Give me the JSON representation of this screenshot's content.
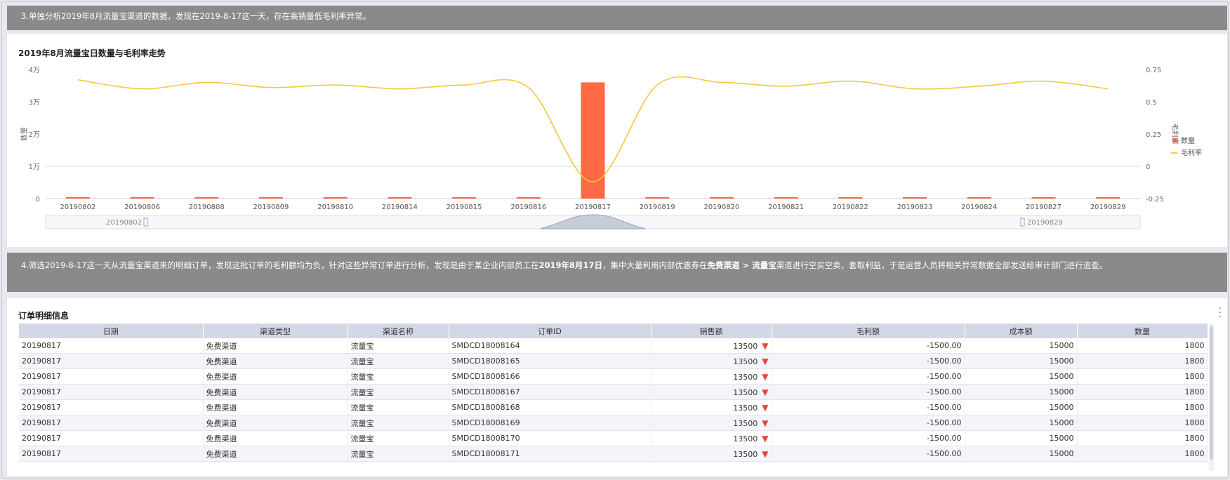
{
  "banners": {
    "top": "3.单独分析2019年8月流量宝渠道的数据，发现在2019-8-17这一天，存在高销量低毛利率异常。",
    "bottom_parts": [
      {
        "t": "4.筛选2019-8-17这一天从流量宝渠道来的明细订单，发现这批订单的毛利额均为负，针对这些异常订单进行分析，发现是由于某企业内部员工在",
        "b": false
      },
      {
        "t": "2019年8月17日",
        "b": true
      },
      {
        "t": "，集中大量利用内部优惠券在",
        "b": false
      },
      {
        "t": "免费渠道 > 流量宝",
        "b": true
      },
      {
        "t": "渠道进行空买空卖，套取利益，于是运营人员将相关异常数据全部发送给审计部门进行追查。",
        "b": false
      }
    ]
  },
  "chart": {
    "title": "2019年8月流量宝日数量与毛利率走势",
    "zoom_start": "20190802",
    "zoom_end": "20190829"
  },
  "chart_data": {
    "type": "bar+line",
    "categories": [
      "20190802",
      "20190806",
      "20190808",
      "20190809",
      "20190810",
      "20190814",
      "20190815",
      "20190816",
      "20190817",
      "20190819",
      "20190820",
      "20190821",
      "20190822",
      "20190823",
      "20190824",
      "20190827",
      "20190829"
    ],
    "series": [
      {
        "name": "数量",
        "type": "bar",
        "axis": "left",
        "color": "#ff6a45",
        "values": [
          200,
          300,
          250,
          250,
          350,
          250,
          200,
          300,
          36000,
          250,
          300,
          250,
          250,
          250,
          300,
          250,
          200
        ]
      },
      {
        "name": "毛利率",
        "type": "line",
        "axis": "right",
        "color": "#f5c842",
        "values": [
          0.67,
          0.6,
          0.65,
          0.61,
          0.63,
          0.6,
          0.63,
          0.61,
          -0.12,
          0.63,
          0.65,
          0.62,
          0.66,
          0.6,
          0.62,
          0.66,
          0.6
        ]
      }
    ],
    "ylabel_left": "数量",
    "ylabel_right": "毛利率",
    "ylim_left": [
      0,
      40000
    ],
    "ylim_right": [
      -0.25,
      0.75
    ],
    "yticks_left": [
      "0",
      "1万",
      "2万",
      "3万",
      "4万"
    ],
    "yticks_right": [
      "-0.25",
      "0",
      "0.25",
      "0.5",
      "0.75"
    ],
    "legend_position": "right"
  },
  "table": {
    "title": "订单明细信息",
    "columns": [
      "日期",
      "渠道类型",
      "渠道名称",
      "订单ID",
      "销售额",
      "毛利额",
      "成本额",
      "数量"
    ],
    "rows": [
      [
        "20190817",
        "免费渠道",
        "流量宝",
        "SMDCD18008164",
        "13500",
        "-1500.00",
        "15000",
        "1800"
      ],
      [
        "20190817",
        "免费渠道",
        "流量宝",
        "SMDCD18008165",
        "13500",
        "-1500.00",
        "15000",
        "1800"
      ],
      [
        "20190817",
        "免费渠道",
        "流量宝",
        "SMDCD18008166",
        "13500",
        "-1500.00",
        "15000",
        "1800"
      ],
      [
        "20190817",
        "免费渠道",
        "流量宝",
        "SMDCD18008167",
        "13500",
        "-1500.00",
        "15000",
        "1800"
      ],
      [
        "20190817",
        "免费渠道",
        "流量宝",
        "SMDCD18008168",
        "13500",
        "-1500.00",
        "15000",
        "1800"
      ],
      [
        "20190817",
        "免费渠道",
        "流量宝",
        "SMDCD18008169",
        "13500",
        "-1500.00",
        "15000",
        "1800"
      ],
      [
        "20190817",
        "免费渠道",
        "流量宝",
        "SMDCD18008170",
        "13500",
        "-1500.00",
        "15000",
        "1800"
      ],
      [
        "20190817",
        "免费渠道",
        "流量宝",
        "SMDCD18008171",
        "13500",
        "-1500.00",
        "15000",
        "1800"
      ]
    ]
  }
}
